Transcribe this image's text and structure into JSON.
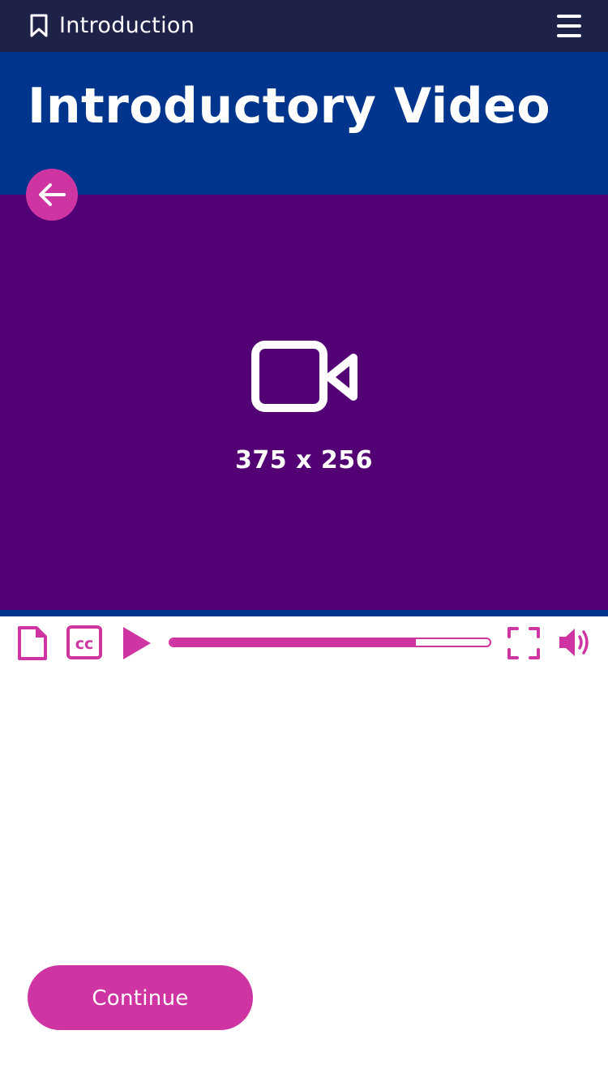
{
  "header": {
    "section_title": "Introduction",
    "bookmark_icon": "bookmark-icon",
    "menu_icon": "hamburger-menu-icon"
  },
  "hero": {
    "title": "Introductory Video"
  },
  "back_button": {
    "icon": "arrow-left-icon"
  },
  "video": {
    "placeholder_icon": "video-camera-icon",
    "dimensions_label": "375 x 256"
  },
  "player_controls": {
    "transcript_icon": "document-icon",
    "captions_icon": "closed-captions-icon",
    "captions_text": "cc",
    "play_icon": "play-icon",
    "progress_fraction": 0.77,
    "fullscreen_icon": "fullscreen-icon",
    "volume_icon": "volume-icon"
  },
  "footer": {
    "continue_label": "Continue"
  },
  "colors": {
    "topbar": "#1f2248",
    "hero": "#00358d",
    "video_bg": "#530075",
    "accent": "#cf35a2",
    "text_on_dark": "#ffffff"
  }
}
